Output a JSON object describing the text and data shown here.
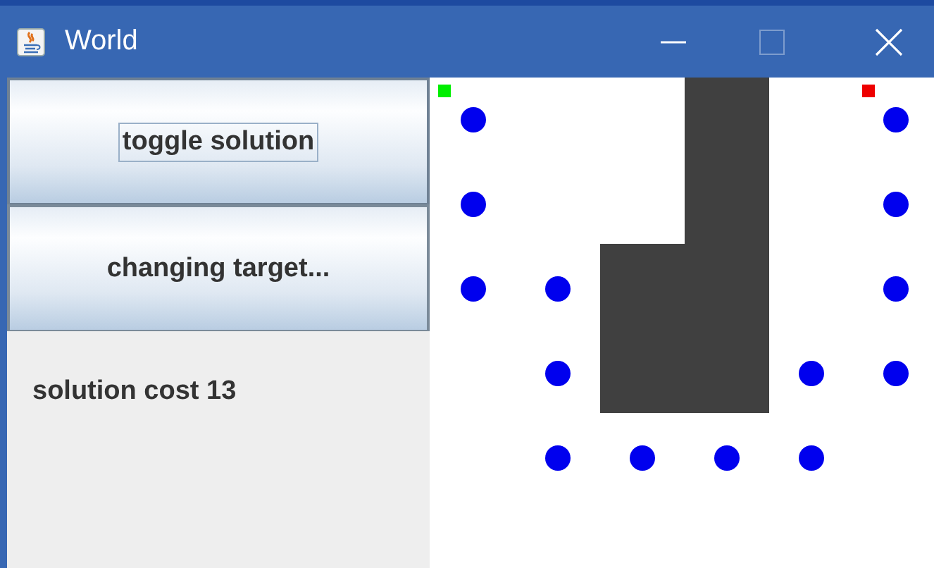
{
  "window": {
    "title": "World",
    "controls": [
      {
        "kind": "minimize",
        "disabled": false
      },
      {
        "kind": "maximize",
        "disabled": true
      },
      {
        "kind": "close",
        "disabled": false
      }
    ]
  },
  "buttons": [
    {
      "label": "toggle solution",
      "focused": true
    },
    {
      "label": "changing target...",
      "focused": false
    }
  ],
  "status": "solution cost 13",
  "world": {
    "rows": [
      {
        "cells": [
          {
            "kind": "start"
          },
          {
            "kind": "empty"
          },
          {
            "kind": "empty"
          },
          {
            "kind": "wall"
          },
          {
            "kind": "empty"
          },
          {
            "kind": "target"
          }
        ]
      },
      {
        "cells": [
          {
            "kind": "dot"
          },
          {
            "kind": "empty"
          },
          {
            "kind": "empty"
          },
          {
            "kind": "wall"
          },
          {
            "kind": "empty"
          },
          {
            "kind": "dot"
          }
        ]
      },
      {
        "cells": [
          {
            "kind": "dot"
          },
          {
            "kind": "dot"
          },
          {
            "kind": "wall"
          },
          {
            "kind": "wall"
          },
          {
            "kind": "empty"
          },
          {
            "kind": "dot"
          }
        ]
      },
      {
        "cells": [
          {
            "kind": "empty"
          },
          {
            "kind": "dot"
          },
          {
            "kind": "wall"
          },
          {
            "kind": "wall"
          },
          {
            "kind": "dot"
          },
          {
            "kind": "dot"
          }
        ]
      },
      {
        "cells": [
          {
            "kind": "empty"
          },
          {
            "kind": "dot"
          },
          {
            "kind": "dot"
          },
          {
            "kind": "dot"
          },
          {
            "kind": "dot"
          },
          {
            "kind": "empty"
          }
        ]
      }
    ]
  }
}
